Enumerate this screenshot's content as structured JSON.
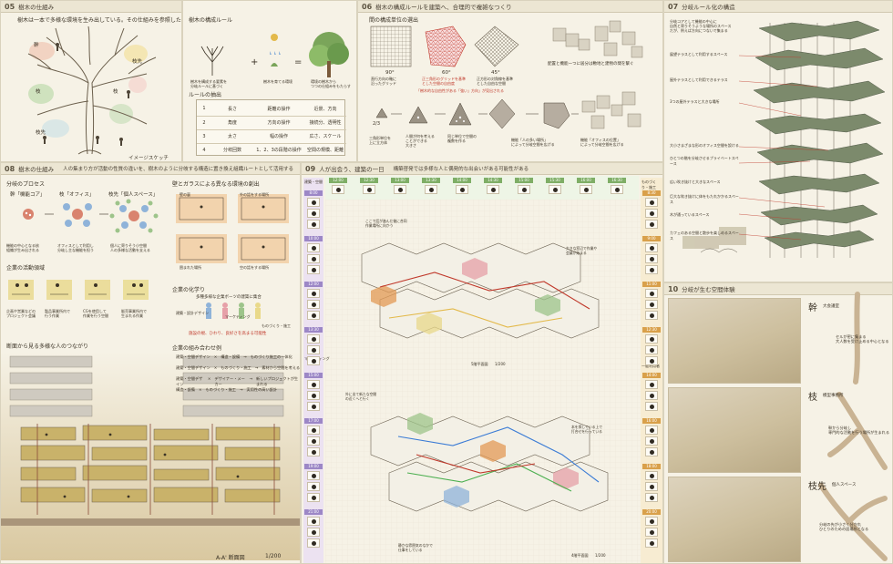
{
  "p05": {
    "num": "05",
    "title": "樹木の仕組み",
    "lead": "樹木は一本で多様な環境を生み出している。その仕組みを参照した",
    "sketch_label": "イメージスケッチ",
    "labels": {
      "trunk_l": "幹",
      "branch": "枝先",
      "branch_r": "枝",
      "twig": "枝先",
      "twig_l": "枝"
    }
  },
  "rule": {
    "title": "樹木の構成ルール",
    "sub": "ルールの抽出",
    "rows": [
      {
        "n": "1",
        "a": "長さ",
        "b": "距離の操作",
        "c": "近景、方向"
      },
      {
        "n": "2",
        "a": "角度",
        "b": "方向の操作",
        "c": "接続分、透明性"
      },
      {
        "n": "3",
        "a": "太さ",
        "b": "幅の操作",
        "c": "広さ、スケール"
      },
      {
        "n": "4",
        "a": "分岐回数",
        "b": "1、2、3の段階の操作",
        "c": "空間の規模、距離"
      }
    ],
    "caption_l": "樹木を構成する要素を\n分岐ルールに基づく",
    "caption_m": "樹木を育てる環境",
    "caption_r": "環境の樹木から\nつつの仕組みをもたらす"
  },
  "p06": {
    "num": "06",
    "title": "樹木の構成ルールを建築へ、合理的で複雑なつくり",
    "sub": "間の構成単位の選出",
    "angles": [
      "90°",
      "60°",
      "45°"
    ],
    "angle_notes": [
      "直行方向の軸に\n沿ったグリッド",
      "正三角形のグリッドを基準\nとした空間の自由度",
      "正方形の対角線を基準\nとした自由な空間"
    ],
    "note_red": "「樹木的な自由性がある「強い」方向」が見出される",
    "right_note": "配置と機能一つに居分は敷地と建物の間を繋ぐ",
    "steps": [
      "2/3",
      "3",
      "4"
    ],
    "step_notes": [
      "三角形単位を\n上に立方体",
      "人間が何を考える\nことができる\n大きさ",
      "同じ単位で空間の\n複数を作る",
      "機能「人の多い場所」\nによって分岐空間を広げる",
      "機能「オフィスの位置」\nによって分岐空間を広げる"
    ]
  },
  "p07": {
    "num": "07",
    "title": "分岐ルール化の構造",
    "intro": "分岐コアとして機能の中心に\n自然と寄りそうような場所のスペース\nだが、例えば方向につないで集まる",
    "callouts": [
      "展望テラスとして利用するスペース",
      "屋外テラスとして利用できるテラス",
      "3つの屋外テラスと大きな場所",
      "大小さまざまな形のオフィス空間を設ける",
      "ひとつの階を分岐させるプライベートスペース",
      "広い吹き抜けと大きなスペース",
      "巨大な吹き抜けに体をもたれかかるスペース",
      "木が通っているスペース",
      "カフェのある空間と散歩を楽しめるスペース"
    ]
  },
  "p08": {
    "num": "08",
    "title": "樹木の仕組み",
    "lead": "人の集まり方が活動の性質の違いを、樹木のように分岐する構造に置き換え組織ルートとして活用する",
    "process_title": "分岐のプロセス",
    "process": [
      "幹「機能コア」",
      "枝「オフィス」",
      "枝先「個人スペース」"
    ],
    "process_notes": [
      "機能の中心となる核\n組織が生み出される",
      "オフィスとして利用し\n分岐し主な機能を担う",
      "個人に寄りそう小空間\n人の多様な活動を支える"
    ],
    "activity_title": "企業の活動領域",
    "activities": [
      "企画や営業などの\nプロジェクト会議",
      "製品事業所内で\n行う作業",
      "CGを使用して\n作業を行う空間",
      "販売事業所内で\n生まれる作業"
    ],
    "section_title": "断面から見る多様な人のつながり",
    "section_label": "A-A' 断面図",
    "section_scale": "1/200",
    "wall_title": "壁とガラスによる異なる環境の創出",
    "wall_captions": [
      "壁の裏",
      "外の話をする場所",
      "囲まれた場所",
      "空の話をする場所"
    ],
    "flow_title": "企業の化学り",
    "flow_intro": "多種多様な企業ボーツの建築に集合",
    "flow_roles": [
      "建築・設計デザイン",
      "ものづくり・施工",
      "マーケティング"
    ],
    "flow_note": "施設の規、ひわり、良好さを高まる可能性",
    "combo_title": "企業の組み合わせ例",
    "combos": [
      [
        "建築・空間デザイン",
        "構造・設備",
        "ものづくり施工の一体化"
      ],
      [
        "建築・空間デザイン",
        "ものづくり・施工",
        "素材から空間を考える"
      ],
      [
        "建築・空間デザイン",
        "デザイナー・メーカー",
        "新しいプロジェクトが生まれる"
      ],
      [
        "構造・設備",
        "ものづくり・施工",
        "実用性の高い設計"
      ]
    ]
  },
  "p09": {
    "num": "09",
    "title": "人が出会う、建築の一日",
    "lead": "構築啓発では多様な人と偶発的な出会いがある可能性がある",
    "left_times": [
      "8:00",
      "10:00",
      "12:00",
      "13:30",
      "15:00",
      "17:00",
      "19:00",
      "21:00"
    ],
    "right_times": [
      "8:30",
      "9:00",
      "11:00",
      "12:30",
      "14:00",
      "16:00",
      "18:00",
      "20:00"
    ],
    "top_times": [
      "12:00",
      "12:30",
      "13:00",
      "13:30",
      "14:00",
      "14:30",
      "15:00",
      "15:30",
      "16:00",
      "16:30"
    ],
    "floor_5": "5階平面図",
    "floor_5_scale": "1/200",
    "floor_4": "4階平面図",
    "floor_4_scale": "1/200",
    "left_cats": [
      "建築・空間",
      "マーケティング",
      "デザイン"
    ],
    "right_cats": [
      "ものづくり・施工",
      "一般利用者"
    ],
    "notes": [
      "ここで話が進んだ後に合同\n作業場所に向かう",
      "大きな窓辺で作業や\n会議が始まる",
      "外に出て新たな空間\nの近くへと行く",
      "本を探している上で\n打合せを行っている",
      "静かな雰囲気のなかで\n仕事をしている"
    ]
  },
  "p10": {
    "num": "10",
    "title": "分岐が生む空間体験",
    "rows": [
      {
        "big": "幹",
        "small": "大会議室",
        "note": "セルが密に集まる\n大人数を受け止める中心となる"
      },
      {
        "big": "枝",
        "small": "模型事務所",
        "note": "幹から分岐し\n専門的な活動を行う場所が生まれる"
      },
      {
        "big": "枝先",
        "small": "個人スペース",
        "note": "分岐の先が小さく分かれ\nひとりのための居場所となる"
      }
    ]
  },
  "colors": {
    "paper": "#f3efe2",
    "panel": "#f6f2e6",
    "ink": "#3b3326",
    "accent_red": "#c0392b",
    "pink": "#e6a0a8",
    "green": "#9dc48a",
    "yellow": "#e9d98a",
    "blue": "#8fb3d9",
    "purple": "#9c87c6",
    "orange": "#e39a55"
  }
}
